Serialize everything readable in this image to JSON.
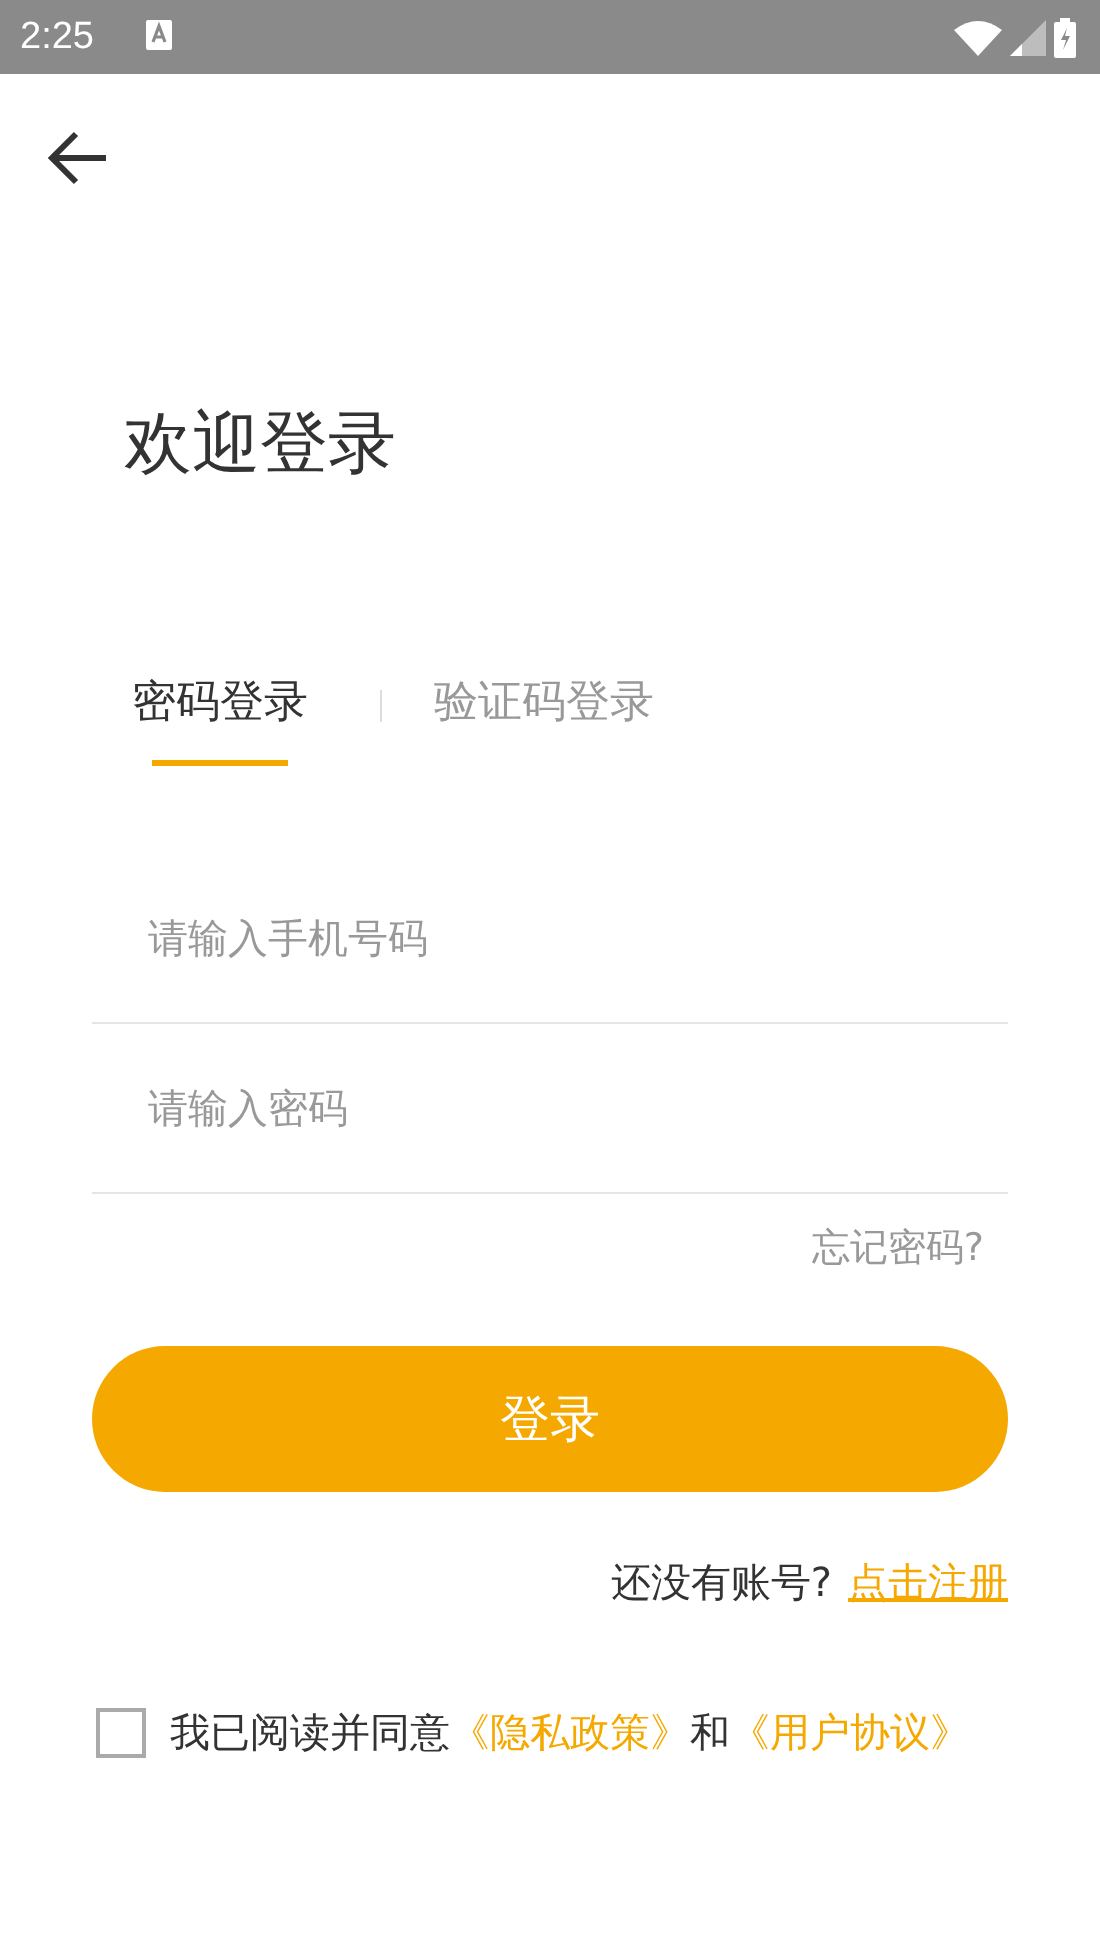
{
  "status_bar": {
    "time": "2:25"
  },
  "title": "欢迎登录",
  "tabs": [
    {
      "label": "密码登录",
      "selected": true
    },
    {
      "label": "验证码登录",
      "selected": false
    }
  ],
  "fields": [
    {
      "placeholder": "请输入手机号码"
    },
    {
      "placeholder": "请输入密码"
    }
  ],
  "forgot_link": "忘记密码?",
  "login_button": "登录",
  "register": {
    "prompt": "还没有账号?",
    "link": "点击注册"
  },
  "agreement": {
    "checked": false,
    "text": "我已阅读并同意",
    "privacy_link": "《隐私政策》",
    "conjunction": "和",
    "terms_link": "《用户协议》"
  }
}
